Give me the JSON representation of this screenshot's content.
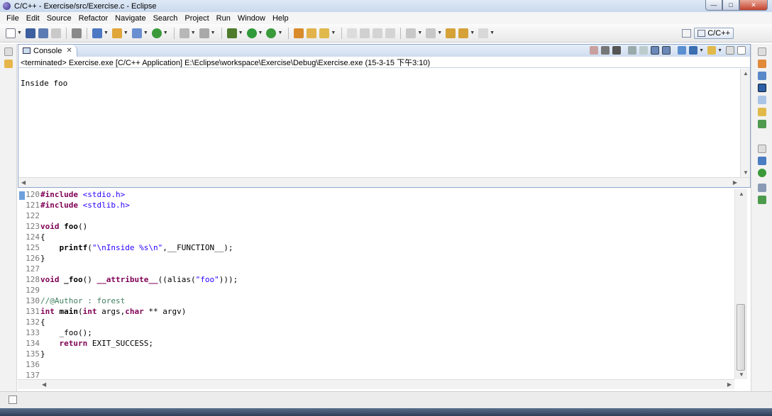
{
  "window": {
    "title": "C/C++ - Exercise/src/Exercise.c - Eclipse",
    "controls": {
      "minimize": "—",
      "maximize": "□",
      "close": "✕"
    }
  },
  "menubar": {
    "items": [
      "File",
      "Edit",
      "Source",
      "Refactor",
      "Navigate",
      "Search",
      "Project",
      "Run",
      "Window",
      "Help"
    ]
  },
  "toolbar": {
    "perspective_label": "C/C++"
  },
  "console": {
    "tab_label": "Console",
    "tab_close": "✕",
    "status": "<terminated> Exercise.exe [C/C++ Application] E:\\Eclipse\\workspace\\Exercise\\Debug\\Exercise.exe (15-3-15 下午3:10)",
    "output": "Inside foo"
  },
  "editor": {
    "lines": [
      {
        "n": "120",
        "parts": [
          [
            "kw",
            "#include"
          ],
          [
            "",
            " "
          ],
          [
            "str",
            "<stdio.h>"
          ]
        ]
      },
      {
        "n": "121",
        "parts": [
          [
            "kw",
            "#include"
          ],
          [
            "",
            " "
          ],
          [
            "str",
            "<stdlib.h>"
          ]
        ]
      },
      {
        "n": "122",
        "parts": []
      },
      {
        "n": "123",
        "parts": [
          [
            "kw",
            "void"
          ],
          [
            "",
            " "
          ],
          [
            "fn",
            "foo"
          ],
          [
            "",
            "()"
          ]
        ]
      },
      {
        "n": "124",
        "parts": [
          [
            "",
            "{"
          ]
        ]
      },
      {
        "n": "125",
        "parts": [
          [
            "",
            "    "
          ],
          [
            "fn",
            "printf"
          ],
          [
            "",
            "("
          ],
          [
            "str",
            "\"\\nInside %s\\n\""
          ],
          [
            "",
            ",__FUNCTION__);"
          ]
        ]
      },
      {
        "n": "126",
        "parts": [
          [
            "",
            "}"
          ]
        ]
      },
      {
        "n": "127",
        "parts": []
      },
      {
        "n": "128",
        "parts": [
          [
            "kw",
            "void"
          ],
          [
            "",
            " "
          ],
          [
            "fn",
            "_foo"
          ],
          [
            "",
            "() "
          ],
          [
            "kw",
            "__attribute__"
          ],
          [
            "",
            "((alias("
          ],
          [
            "str",
            "\"foo\""
          ],
          [
            "",
            ")));"
          ]
        ]
      },
      {
        "n": "129",
        "parts": []
      },
      {
        "n": "130",
        "parts": [
          [
            "cmt",
            "//@Author : forest"
          ]
        ]
      },
      {
        "n": "131",
        "parts": [
          [
            "kw",
            "int"
          ],
          [
            "",
            " "
          ],
          [
            "fn",
            "main"
          ],
          [
            "",
            "("
          ],
          [
            "kw",
            "int"
          ],
          [
            "",
            " args,"
          ],
          [
            "kw",
            "char"
          ],
          [
            "",
            " ** argv)"
          ]
        ]
      },
      {
        "n": "132",
        "parts": [
          [
            "",
            "{"
          ]
        ]
      },
      {
        "n": "133",
        "parts": [
          [
            "",
            "    _foo();"
          ]
        ]
      },
      {
        "n": "134",
        "parts": [
          [
            "",
            "    "
          ],
          [
            "kw",
            "return"
          ],
          [
            "",
            " EXIT_SUCCESS;"
          ]
        ]
      },
      {
        "n": "135",
        "parts": [
          [
            "",
            "}"
          ]
        ]
      },
      {
        "n": "136",
        "parts": []
      },
      {
        "n": "137",
        "parts": []
      }
    ]
  }
}
